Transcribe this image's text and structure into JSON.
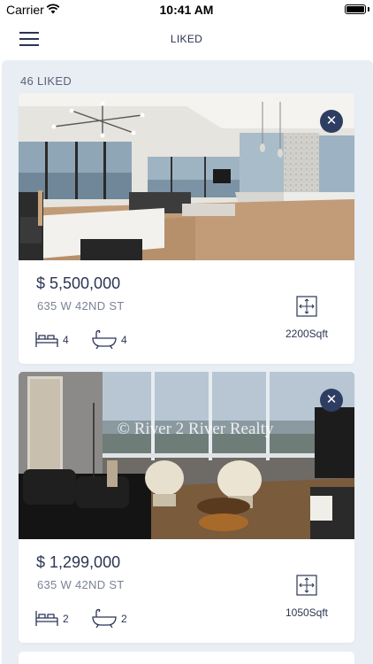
{
  "status": {
    "carrier": "Carrier",
    "time": "10:41 AM"
  },
  "nav": {
    "title": "LIKED",
    "menu_icon": "hamburger-menu-icon"
  },
  "liked": {
    "count_label": "46 LIKED",
    "listings": [
      {
        "price": "$ 5,500,000",
        "address": "635 W 42ND ST",
        "beds": "4",
        "baths": "4",
        "area": "2200Sqft",
        "photo": "loft-living-room-with-kitchen"
      },
      {
        "price": "$ 1,299,000",
        "address": "635 W 42ND ST",
        "beds": "2",
        "baths": "2",
        "area": "1050Sqft",
        "photo": "living-room-with-river-view",
        "watermark": "© River 2 River Realty"
      }
    ]
  },
  "colors": {
    "accent": "#2e3d62",
    "text": "#2b3553",
    "muted": "#7b8296",
    "background": "#e9edf4"
  }
}
